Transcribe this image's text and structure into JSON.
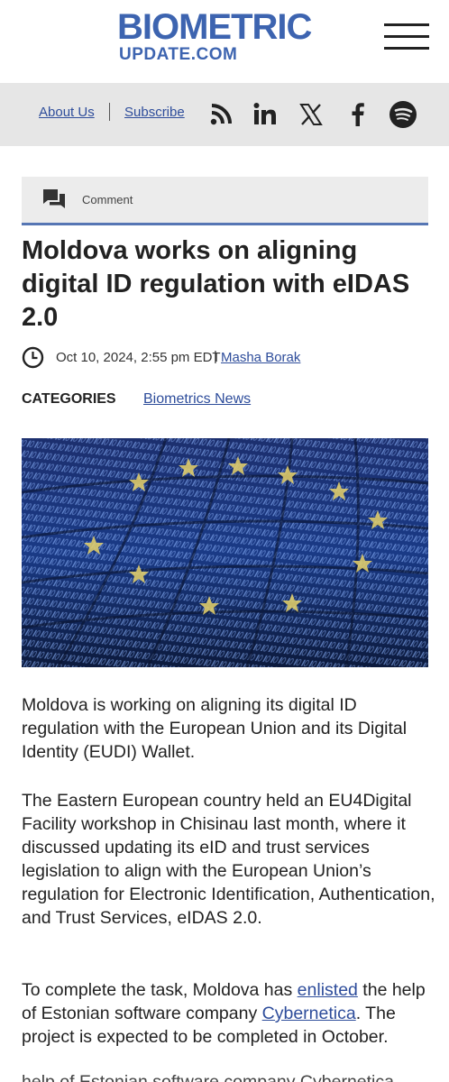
{
  "header": {
    "logo_line1": "BIOMETRIC",
    "logo_line2": "UPDATE.COM",
    "menu_icon": "hamburger-icon",
    "brand_color": "#3d64b0"
  },
  "topbar": {
    "about_label": "About Us",
    "subscribe_label": "Subscribe",
    "social_icons": [
      "rss-icon",
      "linkedin-icon",
      "x-icon",
      "facebook-icon",
      "spotify-icon"
    ]
  },
  "comment_bar": {
    "icon": "comment-icon",
    "label": "Comment"
  },
  "article": {
    "title": "Moldova works on aligning digital ID regulation with eIDAS 2.0",
    "date": "Oct 10, 2024, 2:55 pm EDT",
    "separator": "|",
    "author": "Masha Borak",
    "categories_label": "CATEGORIES",
    "category": "Biometrics News",
    "p1": "Moldova is working on aligning its digital ID regulation with the European Union and its Digital Identity (EUDI) Wallet.",
    "p2": "The Eastern European country held an EU4Digital Facility workshop in Chisinau last month, where it discussed updating its eID and trust services legislation to align with the European Union’s regulation for Electronic Identification, Authentication, and Trust Services, eIDAS 2.0.",
    "p3_a": "To complete the task, Moldova has ",
    "p3_link1": "enlisted",
    "p3_b": " the help of Estonian software company ",
    "p3_link2": "Cybernetica",
    "p3_c": ". The project is expected to be completed in October.",
    "p4": "help of Estonian software company Cybernetica"
  },
  "colors": {
    "link": "#2e4d9b",
    "accent_rule": "#5676b4",
    "gray_bar": "#e6e6e6"
  }
}
